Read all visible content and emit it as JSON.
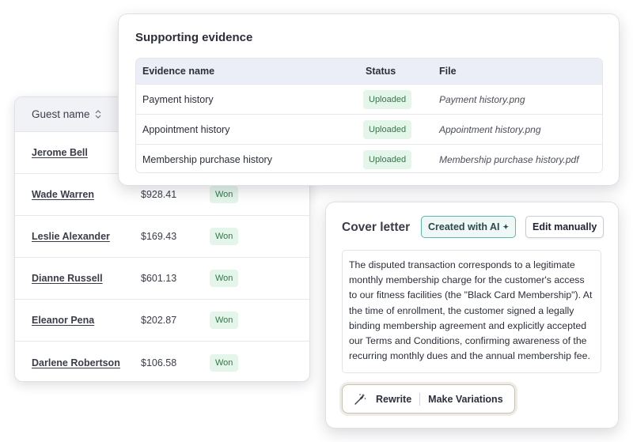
{
  "guests": {
    "header_label": "Guest name",
    "rows": [
      {
        "name": "Jerome Bell",
        "amount": "",
        "status": ""
      },
      {
        "name": "Wade Warren",
        "amount": "$928.41",
        "status": "Won"
      },
      {
        "name": "Leslie Alexander",
        "amount": "$169.43",
        "status": "Won"
      },
      {
        "name": "Dianne Russell",
        "amount": "$601.13",
        "status": "Won"
      },
      {
        "name": "Eleanor Pena",
        "amount": "$202.87",
        "status": "Won"
      },
      {
        "name": "Darlene Robertson",
        "amount": "$106.58",
        "status": "Won"
      }
    ]
  },
  "evidence": {
    "title": "Supporting evidence",
    "columns": {
      "name": "Evidence name",
      "status": "Status",
      "file": "File"
    },
    "rows": [
      {
        "name": "Payment history",
        "status": "Uploaded",
        "file": "Payment history.png"
      },
      {
        "name": "Appointment history",
        "status": "Uploaded",
        "file": "Appointment history.png"
      },
      {
        "name": "Membership purchase history",
        "status": "Uploaded",
        "file": "Membership purchase history.pdf"
      }
    ]
  },
  "cover_letter": {
    "title": "Cover letter",
    "ai_badge": "Created with AI",
    "edit_label": "Edit manually",
    "body": "The disputed transaction corresponds to a legitimate monthly membership charge for the customer's access to our fitness facilities (the \"Black Card Membership\"). At the time of enrollment, the customer signed a legally binding membership agreement and explicitly accepted our Terms and Conditions, confirming awareness of the recurring monthly dues and the annual membership fee.",
    "toolbar": {
      "rewrite_label": "Rewrite",
      "variations_label": "Make Variations"
    }
  },
  "colors": {
    "badge_bg": "#e4f5ea",
    "badge_text": "#2f7a47",
    "ai_border": "#5fb6ad",
    "table_header_bg": "#eceef7"
  },
  "icons": [
    "sort-icon",
    "magic-wand-icon",
    "sparkle-icon"
  ]
}
